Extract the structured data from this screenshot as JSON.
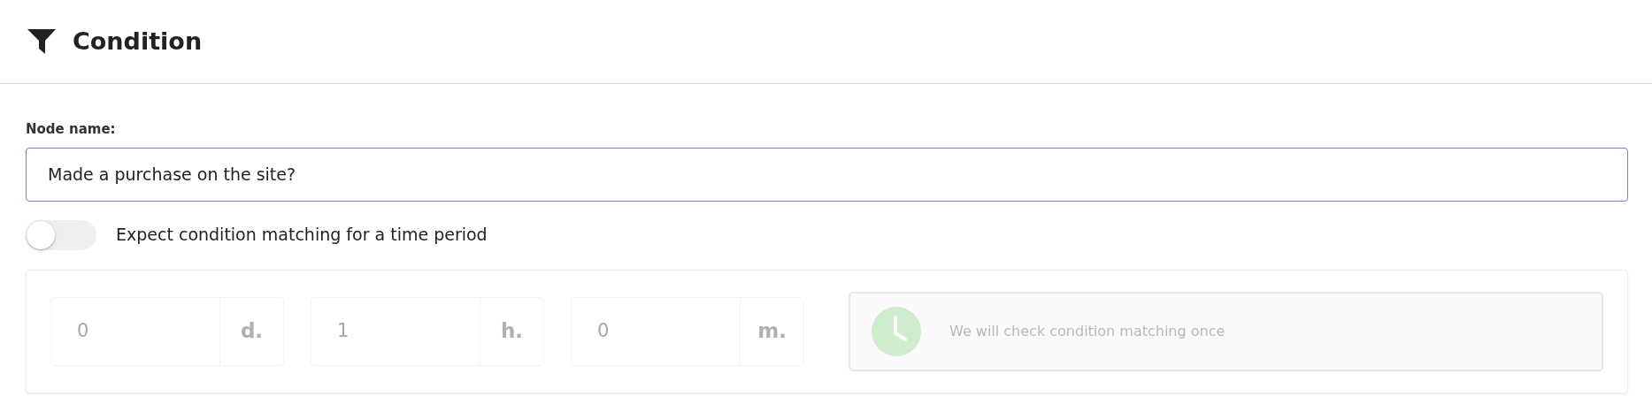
{
  "header": {
    "title": "Condition"
  },
  "node_name": {
    "label": "Node name:",
    "value": "Made a purchase on the site?"
  },
  "toggle": {
    "label": "Expect condition matching for a time period",
    "on": false
  },
  "period": {
    "disabled": true,
    "fields": [
      {
        "value": "0",
        "unit": "d."
      },
      {
        "value": "1",
        "unit": "h."
      },
      {
        "value": "0",
        "unit": "m."
      }
    ],
    "info": "We will check condition matching once"
  }
}
